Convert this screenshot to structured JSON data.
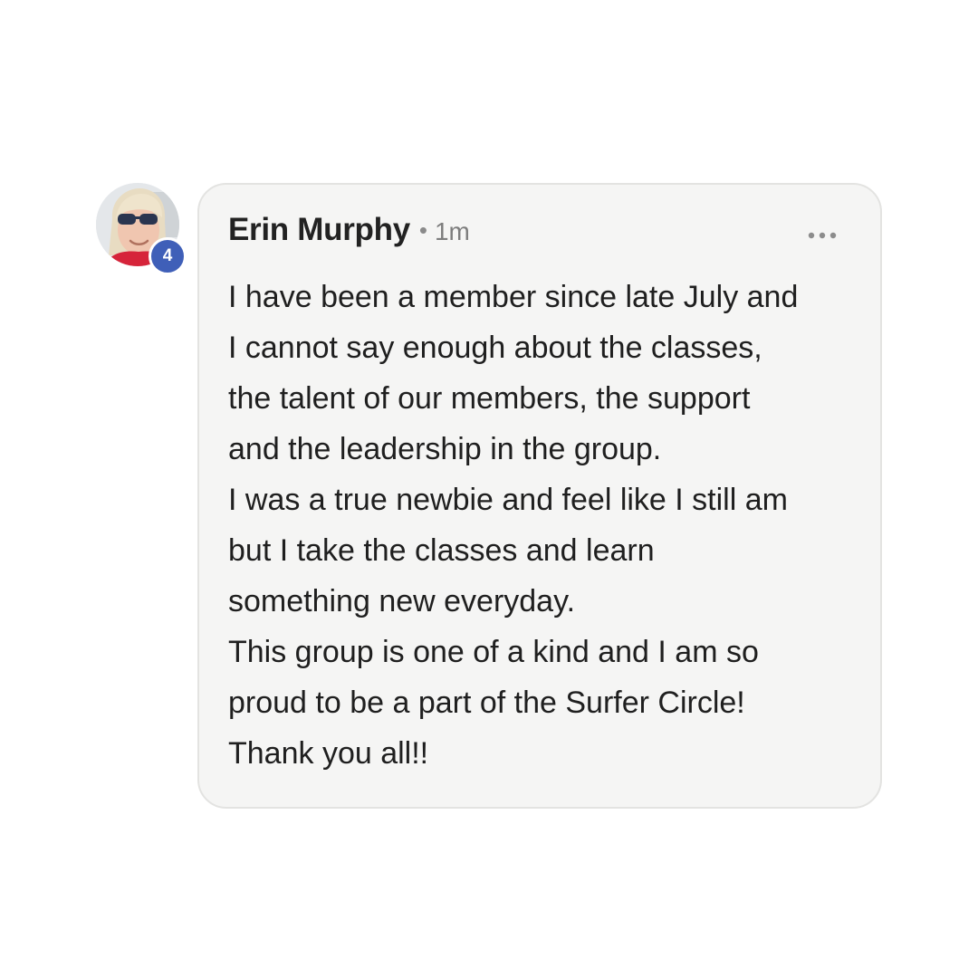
{
  "comment": {
    "author": {
      "name": "Erin Murphy",
      "avatar_icon": "user-avatar-photo",
      "level_badge": "4",
      "level_badge_color": "#3f5fb8"
    },
    "separator": "•",
    "timestamp": "1m",
    "more_icon": "more-horizontal-icon",
    "body_lines": [
      "I have been a member since late July and",
      "I cannot say enough about the classes,",
      "the talent of our members, the support",
      "and the leadership in the group.",
      "I was a true newbie and feel like I still am",
      "but I take the classes and learn",
      "something new everyday.",
      "This group is one of a kind and I am so",
      "proud to be a part of the Surfer Circle!",
      "Thank you all!!"
    ]
  },
  "colors": {
    "card_background": "#f5f5f4",
    "card_border": "#e3e3e1",
    "text_primary": "#1f1f1f",
    "text_secondary": "#7d7d7d"
  }
}
